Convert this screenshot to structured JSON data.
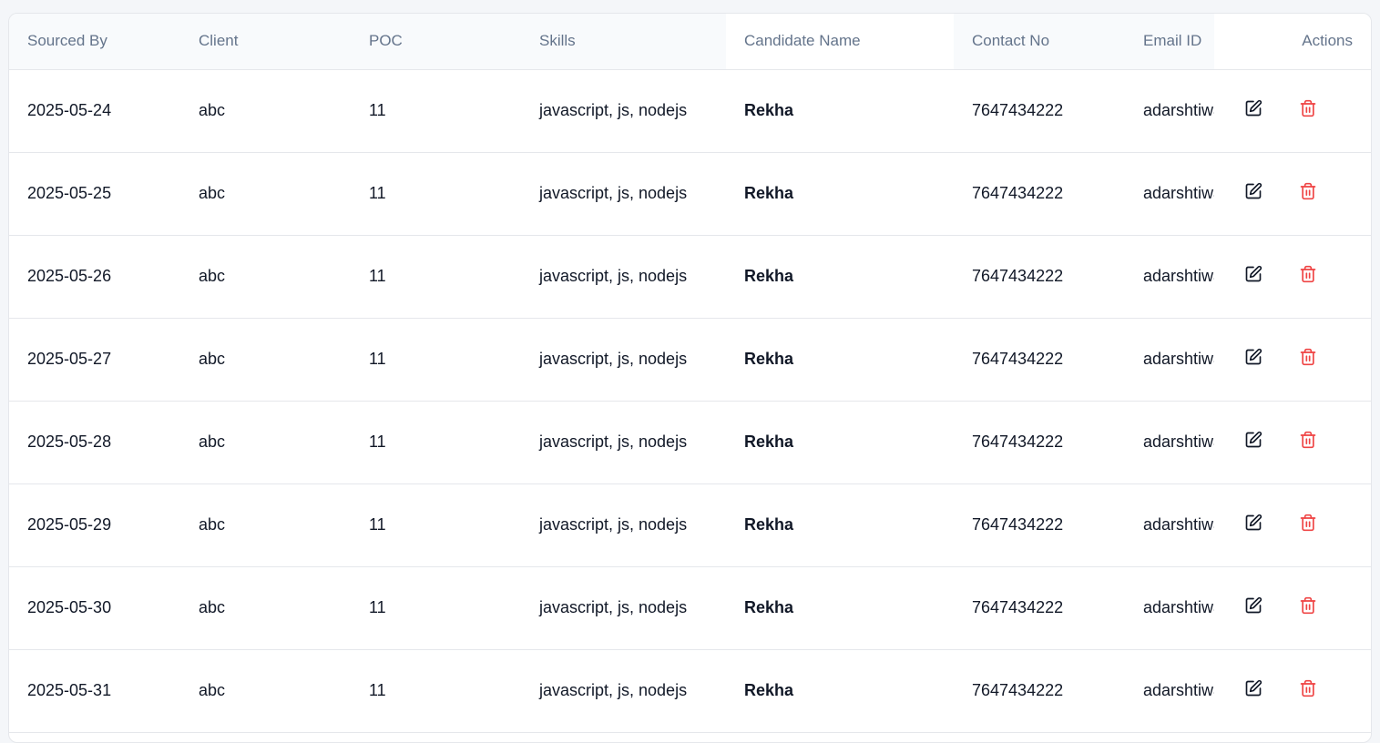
{
  "table": {
    "columns": [
      "Sourced By",
      "Client",
      "POC",
      "Skills",
      "Candidate Name",
      "Contact No",
      "Email ID",
      "Actions"
    ],
    "rows": [
      {
        "sourced_by": "2025-05-24",
        "client": "abc",
        "poc": "11",
        "skills": "javascript, js, nodejs",
        "candidate_name": "Rekha",
        "contact_no": "7647434222",
        "email_id": "adarshtiwari"
      },
      {
        "sourced_by": "2025-05-25",
        "client": "abc",
        "poc": "11",
        "skills": "javascript, js, nodejs",
        "candidate_name": "Rekha",
        "contact_no": "7647434222",
        "email_id": "adarshtiwari"
      },
      {
        "sourced_by": "2025-05-26",
        "client": "abc",
        "poc": "11",
        "skills": "javascript, js, nodejs",
        "candidate_name": "Rekha",
        "contact_no": "7647434222",
        "email_id": "adarshtiwari"
      },
      {
        "sourced_by": "2025-05-27",
        "client": "abc",
        "poc": "11",
        "skills": "javascript, js, nodejs",
        "candidate_name": "Rekha",
        "contact_no": "7647434222",
        "email_id": "adarshtiwari"
      },
      {
        "sourced_by": "2025-05-28",
        "client": "abc",
        "poc": "11",
        "skills": "javascript, js, nodejs",
        "candidate_name": "Rekha",
        "contact_no": "7647434222",
        "email_id": "adarshtiwari"
      },
      {
        "sourced_by": "2025-05-29",
        "client": "abc",
        "poc": "11",
        "skills": "javascript, js, nodejs",
        "candidate_name": "Rekha",
        "contact_no": "7647434222",
        "email_id": "adarshtiwari"
      },
      {
        "sourced_by": "2025-05-30",
        "client": "abc",
        "poc": "11",
        "skills": "javascript, js, nodejs",
        "candidate_name": "Rekha",
        "contact_no": "7647434222",
        "email_id": "adarshtiwari"
      },
      {
        "sourced_by": "2025-05-31",
        "client": "abc",
        "poc": "11",
        "skills": "javascript, js, nodejs",
        "candidate_name": "Rekha",
        "contact_no": "7647434222",
        "email_id": "adarshtiwari"
      }
    ],
    "row_actions": [
      {
        "icon": "edit-icon",
        "color": "#111827"
      },
      {
        "icon": "trash-icon",
        "color": "#ef4444"
      }
    ]
  },
  "colors": {
    "header_bg": "#f8fafc",
    "header_text": "#64748b",
    "border": "#e5e7eb",
    "delete": "#ef4444"
  }
}
